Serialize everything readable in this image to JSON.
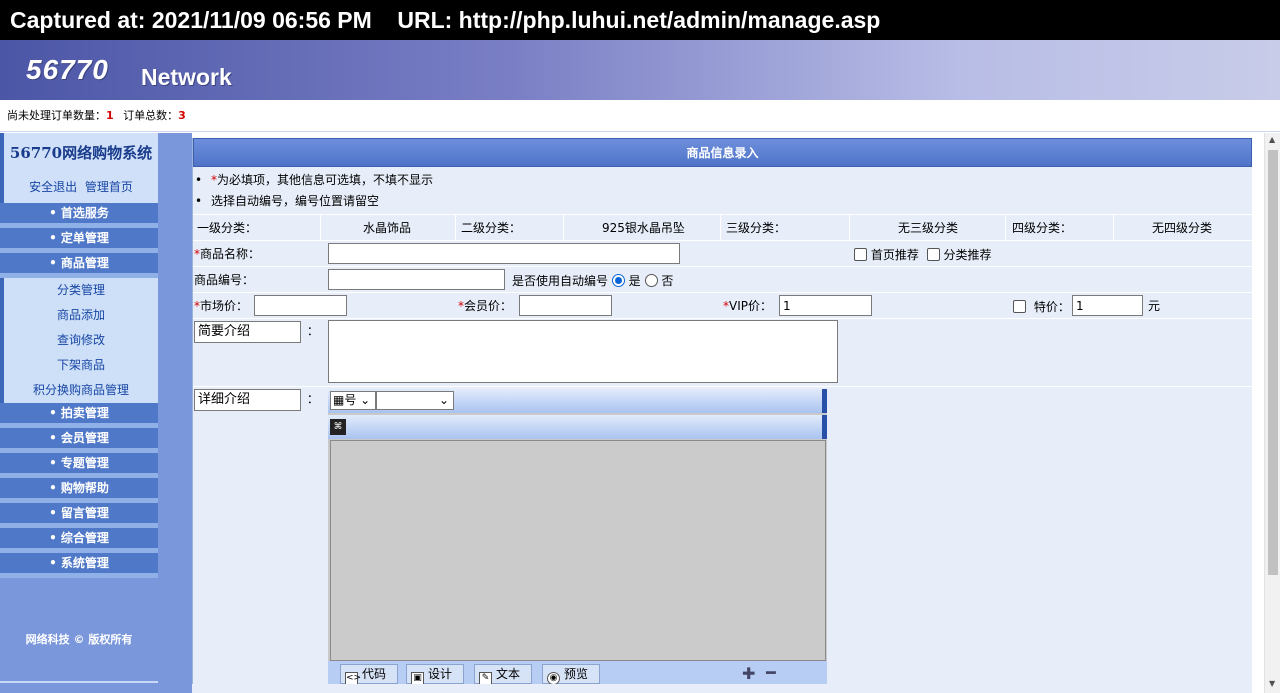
{
  "capture": {
    "text": "Captured at: 2021/11/09 06:56 PM    URL: http://php.luhui.net/admin/manage.asp"
  },
  "banner": {
    "logo": "56770",
    "logo_word": "Network"
  },
  "orders": {
    "pending_label": "尚未处理订单数量：",
    "pending_count": "1",
    "total_label": "订单总数：",
    "total_count": "3"
  },
  "sidebar": {
    "title": "56770网络购物系统",
    "logout": "安全退出",
    "home": "管理首页",
    "menu": [
      "• 首选服务",
      "• 定单管理",
      "• 商品管理"
    ],
    "sub": [
      "分类管理",
      "商品添加",
      "查询修改",
      "下架商品",
      "积分换购商品管理"
    ],
    "menu2": [
      "• 拍卖管理",
      "• 会员管理",
      "• 专题管理",
      "• 购物帮助",
      "• 留言管理",
      "• 综合管理",
      "• 系统管理"
    ],
    "copyright": "网络科技 © 版权所有"
  },
  "form": {
    "title": "商品信息录入",
    "note1_star": "*",
    "note1": "为必填项，其他信息可选填，不填不显示",
    "note2": "选择自动编号，编号位置请留空",
    "cat1_label": "一级分类：",
    "cat1_value": "水晶饰品",
    "cat2_label": "二级分类：",
    "cat2_value": "925银水晶吊坠",
    "cat3_label": "三级分类：",
    "cat3_value": "无三级分类",
    "cat4_label": "四级分类：",
    "cat4_value": "无四级分类",
    "name_star": "*",
    "name_label": "商品名称：",
    "home_recommend": "首页推荐",
    "cat_recommend": "分类推荐",
    "code_label": "商品编号：",
    "auto_code_label": "是否使用自动编号",
    "yes": "是",
    "no": "否",
    "market_star": "*",
    "market_label": "市场价：",
    "member_star": "*",
    "member_label": "会员价：",
    "vip_star": "*",
    "vip_label": "VIP价：",
    "vip_value": "1",
    "special_label": "特价：",
    "special_value": "1",
    "yuan": "元",
    "brief_label": "简要介绍",
    "colon": "：",
    "detail_label": "详细介绍",
    "editor_font_select": "号",
    "editor_tabs": [
      "代码",
      "设计",
      "文本",
      "预览"
    ]
  }
}
